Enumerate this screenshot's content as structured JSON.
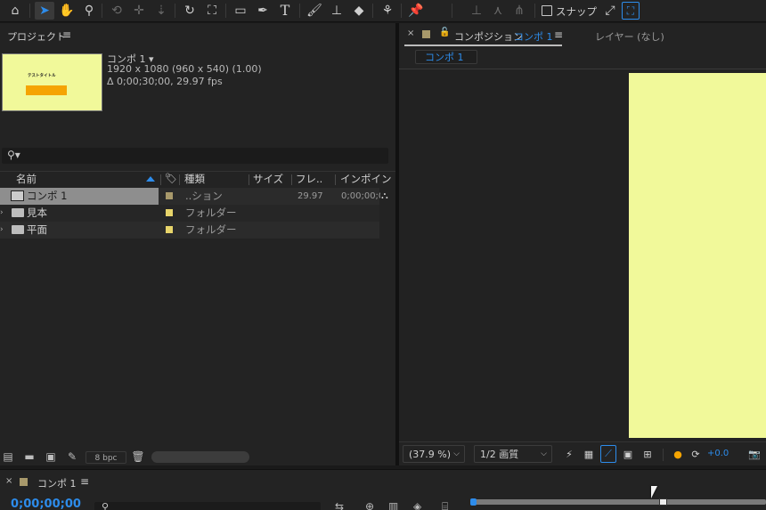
{
  "toolbar": {
    "snap_label": "スナップ"
  },
  "project": {
    "panel_title": "プロジェクト",
    "menu_glyph": "≡",
    "thumb_text": "テストタイトル",
    "selected_name": "コンポ 1 ▾",
    "resolution": "1920 x 1080  (960 x 540) (1.00)",
    "duration": "Δ 0;00;30;00, 29.97 fps",
    "columns": {
      "name": "名前",
      "type": "種類",
      "size": "サイズ",
      "frame": "フレ..",
      "in_point": "インポイント"
    },
    "rows": [
      {
        "name": "コンポ 1",
        "type": "..ション",
        "frame": "29.97",
        "in_point": "0;00;00;0",
        "color": "#a8996b"
      },
      {
        "name": "見本",
        "type": "フォルダー",
        "frame": "",
        "in_point": "",
        "color": "#e7d46a"
      },
      {
        "name": "平面",
        "type": "フォルダー",
        "frame": "",
        "in_point": "",
        "color": "#e7d46a"
      }
    ],
    "footer": {
      "bpc": "8 bpc"
    }
  },
  "composition": {
    "tab_prefix": "コンポジション",
    "tab_name": "コンポ 1",
    "menu_glyph": "≡",
    "layer_tab": "レイヤー (なし)",
    "sub_tab": "コンポ 1",
    "canvas_color": "#f1f99a",
    "zoom": "(37.9 %)",
    "resolution": "1/2 画質",
    "exposure": "+0.0"
  },
  "timeline": {
    "tab_name": "コンポ 1",
    "menu_glyph": "≡",
    "timecode": "0;00;00;00"
  },
  "colors": {
    "accent": "#2d8ceb",
    "canvas": "#f1f99a"
  }
}
